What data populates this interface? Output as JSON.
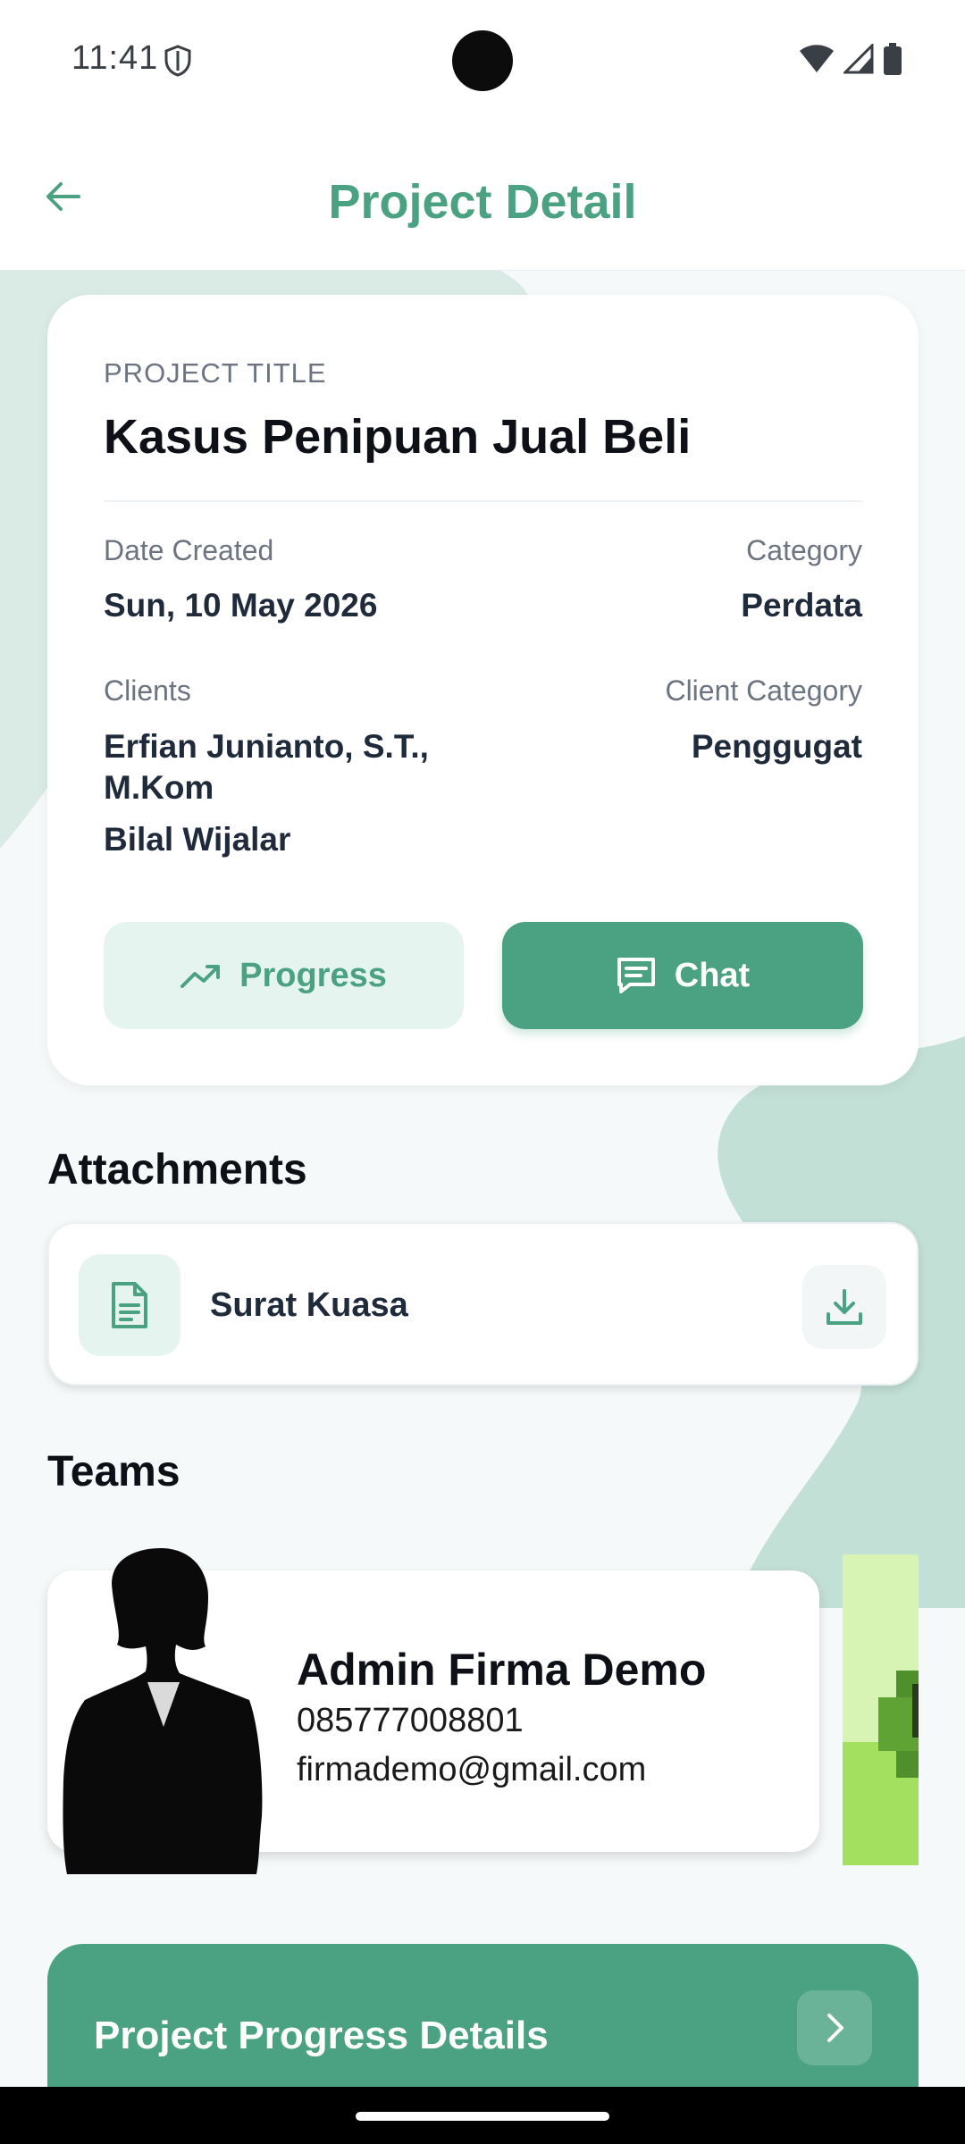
{
  "status_bar": {
    "time": "11:41"
  },
  "header": {
    "title": "Project Detail"
  },
  "project": {
    "title_label": "PROJECT TITLE",
    "title": "Kasus Penipuan Jual Beli",
    "date_created_label": "Date Created",
    "date_created": "Sun, 10 May 2026",
    "category_label": "Category",
    "category": "Perdata",
    "clients_label": "Clients",
    "clients": [
      "Erfian Junianto, S.T.,",
      "M.Kom",
      "Bilal Wijalar"
    ],
    "client_category_label": "Client Category",
    "client_category": "Penggugat"
  },
  "actions": {
    "progress_label": "Progress",
    "chat_label": "Chat"
  },
  "attachments": {
    "heading": "Attachments",
    "items": [
      {
        "name": "Surat Kuasa"
      }
    ]
  },
  "teams": {
    "heading": "Teams",
    "members": [
      {
        "name": "Admin Firma Demo",
        "phone": "085777008801",
        "email": "firmademo@gmail.com"
      }
    ]
  },
  "progress_banner": {
    "label": "Project Progress Details"
  },
  "colors": {
    "accent": "#4aa282",
    "accent_light": "#e6f4f0",
    "blob": "#c3e0d6"
  },
  "icons": [
    "back-arrow-icon",
    "trending-up-icon",
    "chat-icon",
    "document-icon",
    "download-icon",
    "chevron-right-icon"
  ]
}
